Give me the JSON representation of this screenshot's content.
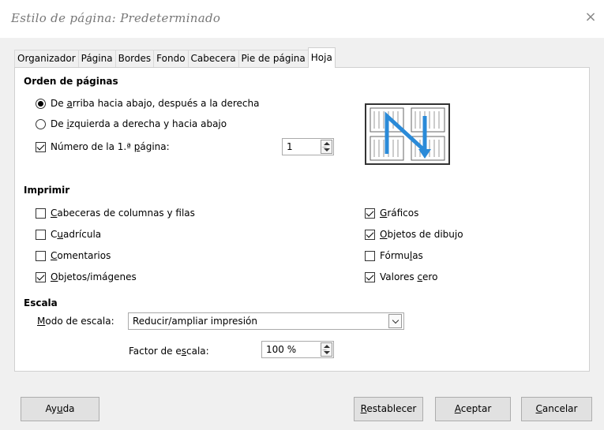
{
  "window": {
    "title": "Estilo de página: Predeterminado",
    "close_glyph": "×"
  },
  "tabs": [
    {
      "label": "Organizador",
      "active": false
    },
    {
      "label": "Página",
      "active": false
    },
    {
      "label": "Bordes",
      "active": false
    },
    {
      "label": "Fondo",
      "active": false
    },
    {
      "label": "Cabecera",
      "active": false
    },
    {
      "label": "Pie de página",
      "active": false
    },
    {
      "label": "Hoja",
      "active": true
    }
  ],
  "page_order": {
    "heading": "Orden de páginas",
    "option_top_down": {
      "pre": "De ",
      "accel": "a",
      "post": "rriba hacia abajo, después a la derecha",
      "selected": true
    },
    "option_left_right": {
      "pre": "De ",
      "accel": "i",
      "post": "zquierda a derecha y hacia abajo",
      "selected": false
    },
    "first_page": {
      "pre": "Número de la 1.ª ",
      "accel": "p",
      "post": "ágina:",
      "checked": true,
      "value": "1"
    }
  },
  "print": {
    "heading": "Imprimir",
    "left": [
      {
        "pre": "",
        "accel": "C",
        "post": "abeceras de columnas y filas",
        "checked": false
      },
      {
        "pre": "C",
        "accel": "u",
        "post": "adrícula",
        "checked": false
      },
      {
        "pre": "",
        "accel": "C",
        "post": "omentarios",
        "checked": false
      },
      {
        "pre": "",
        "accel": "O",
        "post": "bjetos/imágenes",
        "checked": true
      }
    ],
    "right": [
      {
        "pre": "",
        "accel": "G",
        "post": "ráficos",
        "checked": true
      },
      {
        "pre": "",
        "accel": "O",
        "post": "bjetos de dibujo",
        "checked": true
      },
      {
        "pre": "Fórmu",
        "accel": "l",
        "post": "as",
        "checked": false
      },
      {
        "pre": "Valores ",
        "accel": "c",
        "post": "ero",
        "checked": true
      }
    ]
  },
  "scale": {
    "heading": "Escala",
    "mode_label": {
      "pre": "",
      "accel": "M",
      "post": "odo de escala:"
    },
    "mode_value": "Reducir/ampliar impresión",
    "factor_label": {
      "pre": "Factor de e",
      "accel": "s",
      "post": "cala:"
    },
    "factor_value": "100 %"
  },
  "buttons": {
    "help": {
      "pre": "Ay",
      "accel": "u",
      "post": "da"
    },
    "reset": {
      "pre": "",
      "accel": "R",
      "post": "establecer"
    },
    "ok": {
      "pre": "",
      "accel": "A",
      "post": "ceptar"
    },
    "cancel": {
      "pre": "",
      "accel": "C",
      "post": "ancelar"
    }
  },
  "colors": {
    "accent_arrow": "#2a8ad8",
    "background": "#f0f0f0",
    "panel": "#ffffff"
  },
  "icons": [
    "close-icon",
    "page-order-preview-icon",
    "spin-up-icon",
    "spin-down-icon",
    "chevron-down-icon"
  ]
}
